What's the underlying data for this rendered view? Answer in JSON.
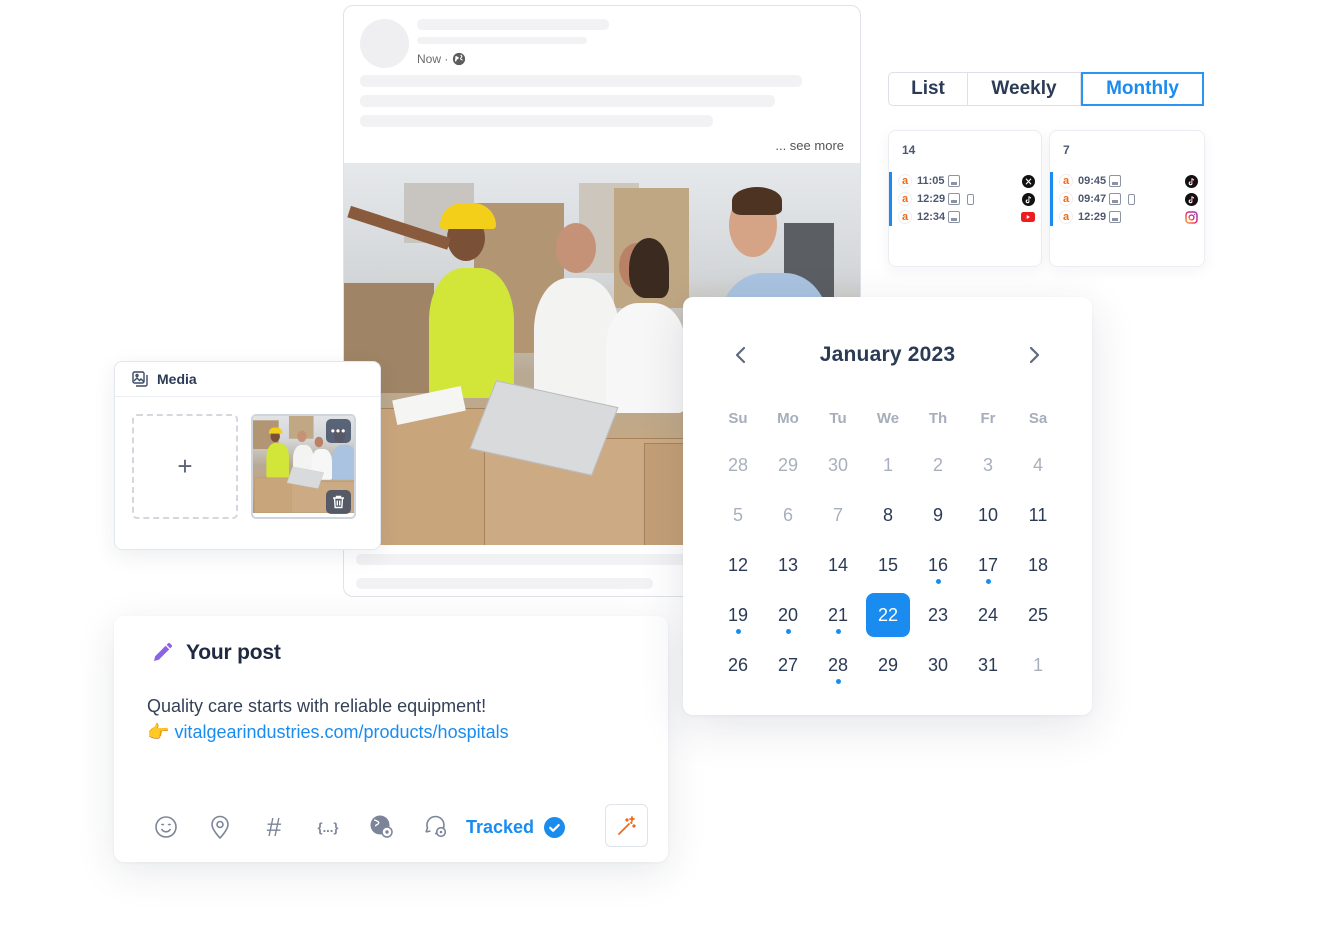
{
  "post_preview": {
    "timestamp": "Now ·",
    "visibility_icon": "globe-icon",
    "see_more": "... see more",
    "image_alt": "Warehouse team reviewing inventory"
  },
  "media": {
    "title": "Media",
    "add_label": "+",
    "thumb_more": "•••",
    "icons": {
      "header": "images-icon",
      "more": "more-horizontal-icon",
      "delete": "trash-icon"
    }
  },
  "your_post": {
    "title": "Your post",
    "text_line1": "Quality care starts with reliable equipment!",
    "pointer_emoji": "👉",
    "link": "vitalgearindustries.com/products/hospitals",
    "tracked_label": "Tracked",
    "toolbar_icons": [
      "smile-icon",
      "location-pin-icon",
      "hashtag-icon",
      "variables-icon",
      "globe-settings-icon",
      "comment-settings-icon"
    ],
    "variables_glyph": "{...}",
    "hashtag_glyph": "#"
  },
  "view_toggle": {
    "options": [
      "List",
      "Weekly",
      "Monthly"
    ],
    "active": "Monthly"
  },
  "day_cards": [
    {
      "day": "14",
      "events": [
        {
          "time": "11:05",
          "media": true,
          "mobile": false,
          "network": "x"
        },
        {
          "time": "12:29",
          "media": true,
          "mobile": true,
          "network": "tiktok"
        },
        {
          "time": "12:34",
          "media": true,
          "mobile": false,
          "network": "youtube"
        }
      ]
    },
    {
      "day": "7",
      "events": [
        {
          "time": "09:45",
          "media": true,
          "mobile": false,
          "network": "tiktok"
        },
        {
          "time": "09:47",
          "media": true,
          "mobile": true,
          "network": "tiktok"
        },
        {
          "time": "12:29",
          "media": true,
          "mobile": false,
          "network": "instagram"
        }
      ]
    }
  ],
  "event_logo": "a",
  "calendar": {
    "title": "January 2023",
    "weekdays": [
      "Su",
      "Mo",
      "Tu",
      "We",
      "Th",
      "Fr",
      "Sa"
    ],
    "selected": "22",
    "weeks": [
      [
        {
          "d": "28",
          "m": true
        },
        {
          "d": "29",
          "m": true
        },
        {
          "d": "30",
          "m": true
        },
        {
          "d": "1",
          "m": true
        },
        {
          "d": "2",
          "m": true
        },
        {
          "d": "3",
          "m": true
        },
        {
          "d": "4",
          "m": true
        }
      ],
      [
        {
          "d": "5",
          "m": true
        },
        {
          "d": "6",
          "m": true
        },
        {
          "d": "7",
          "m": true
        },
        {
          "d": "8"
        },
        {
          "d": "9"
        },
        {
          "d": "10"
        },
        {
          "d": "11"
        }
      ],
      [
        {
          "d": "12"
        },
        {
          "d": "13"
        },
        {
          "d": "14"
        },
        {
          "d": "15"
        },
        {
          "d": "16",
          "dot": true
        },
        {
          "d": "17",
          "dot": true
        },
        {
          "d": "18"
        }
      ],
      [
        {
          "d": "19",
          "dot": true
        },
        {
          "d": "20",
          "dot": true
        },
        {
          "d": "21",
          "dot": true
        },
        {
          "d": "22",
          "sel": true
        },
        {
          "d": "23"
        },
        {
          "d": "24"
        },
        {
          "d": "25"
        }
      ],
      [
        {
          "d": "26"
        },
        {
          "d": "27"
        },
        {
          "d": "28",
          "dot": true
        },
        {
          "d": "29"
        },
        {
          "d": "30"
        },
        {
          "d": "31"
        },
        {
          "d": "1",
          "m": true
        }
      ]
    ]
  },
  "colors": {
    "accent": "#1a8cf0",
    "text_dark": "#2b3a55",
    "muted": "#a9b0bd",
    "pencil": "#8a63e8",
    "magic": "#f06a1d",
    "brand_logo": "#f06a1d"
  }
}
